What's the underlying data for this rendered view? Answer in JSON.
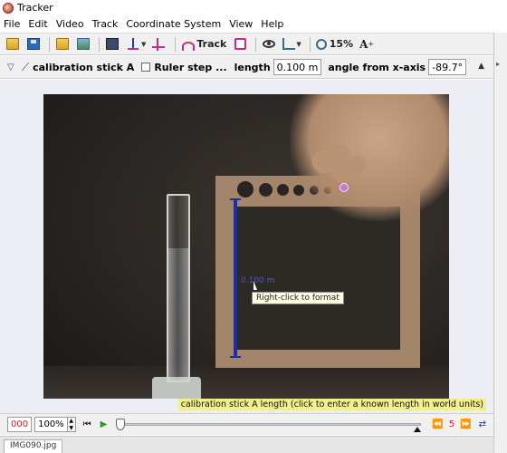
{
  "window": {
    "title": "Tracker"
  },
  "menu": [
    "File",
    "Edit",
    "Video",
    "Track",
    "Coordinate System",
    "View",
    "Help"
  ],
  "toolbar": {
    "track_label": "Track",
    "zoom_label": "15%",
    "font_label": "A"
  },
  "calibration": {
    "name": "calibration stick A",
    "ruler_step_label": "Ruler step ...",
    "length_label": "length",
    "length_value": "0.100 m",
    "angle_label": "angle from x-axis",
    "angle_value": "-89.7°"
  },
  "viewer": {
    "stick_label": "0.100 m",
    "tooltip": "Right-click to format",
    "status_message": "calibration stick A length (click to enter a known length in world units)"
  },
  "player": {
    "frame_number": "000",
    "zoom": "100%",
    "step_size": "5",
    "slider_fraction": 0
  },
  "file_tab": "IMG090.jpg",
  "icons": {
    "open": "open-folder-icon",
    "save": "save-icon",
    "image": "open-image-icon",
    "clip": "clip-settings-icon",
    "axes": "coordinate-axes-icon",
    "tape": "calibration-tools-icon",
    "track": "track-icon",
    "points": "track-points-icon",
    "eye": "visibility-icon",
    "grid": "grid-icon",
    "zoom": "zoom-icon",
    "font": "font-size-icon"
  },
  "colors": {
    "calibration_stick": "#1c2fa8",
    "status_highlight": "#f2f08a",
    "frame_counter": "#cc1f1f"
  }
}
